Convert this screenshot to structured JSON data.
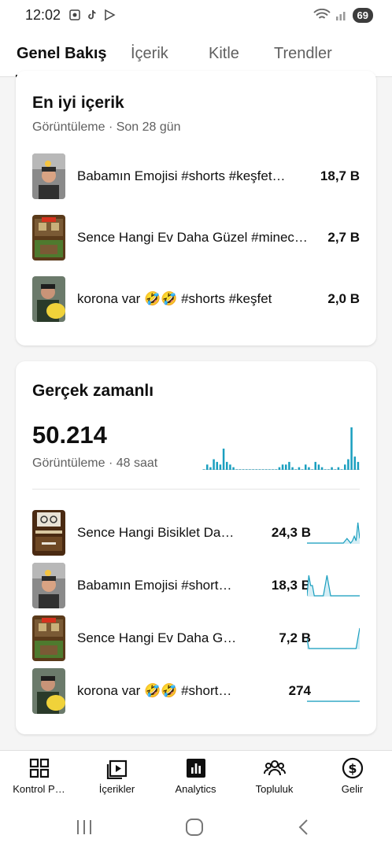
{
  "status": {
    "time": "12:02",
    "battery": "69"
  },
  "tabs": [
    {
      "label": "Genel Bakış",
      "active": true
    },
    {
      "label": "İçerik",
      "active": false
    },
    {
      "label": "Kitle",
      "active": false
    },
    {
      "label": "Trendler",
      "active": false
    }
  ],
  "top_content": {
    "title": "En iyi içerik",
    "subtitle": "Görüntüleme · Son 28 gün",
    "items": [
      {
        "title": "Babamın Emojisi #shorts #keşfet…",
        "value": "18,7 B"
      },
      {
        "title": "Sence Hangi Ev Daha Güzel #minec…",
        "value": "2,7 B"
      },
      {
        "title": "korona var 🤣🤣 #shorts #keşfet",
        "value": "2,0 B"
      }
    ]
  },
  "realtime": {
    "title": "Gerçek zamanlı",
    "total": "50.214",
    "subtitle": "Görüntüleme · 48 saat",
    "hourly_views": [
      0,
      2,
      1,
      4,
      3,
      2,
      8,
      3,
      2,
      1,
      0,
      0,
      0,
      0,
      0,
      0,
      0,
      0,
      0,
      0,
      0,
      0,
      0,
      1,
      2,
      2,
      3,
      1,
      0,
      1,
      0,
      2,
      1,
      0,
      3,
      2,
      1,
      0,
      0,
      1,
      0,
      1,
      0,
      2,
      4,
      16,
      5,
      3
    ],
    "items": [
      {
        "title": "Sence Hangi Bisiklet Da…",
        "value": "24,3 B",
        "spark": [
          0,
          0,
          0,
          0,
          0,
          0,
          0,
          0,
          0,
          0,
          0,
          0,
          0,
          0,
          0,
          0,
          0,
          0,
          0,
          0,
          0,
          1,
          2,
          1,
          0,
          1,
          3,
          1,
          9,
          2
        ]
      },
      {
        "title": "Babamın Emojisi #short…",
        "value": "18,3 B",
        "spark": [
          0,
          2,
          1,
          1,
          0,
          0,
          0,
          0,
          0,
          0,
          1,
          2,
          1,
          0,
          0,
          0,
          0,
          0,
          0,
          0,
          0,
          0,
          0,
          0,
          0,
          0,
          0,
          0,
          0,
          0
        ]
      },
      {
        "title": "Sence Hangi Ev Daha G…",
        "value": "7,2 B",
        "spark": [
          1,
          0,
          0,
          0,
          0,
          0,
          0,
          0,
          0,
          0,
          0,
          0,
          0,
          0,
          0,
          0,
          0,
          0,
          0,
          0,
          0,
          0,
          0,
          0,
          0,
          0,
          0,
          0,
          1,
          2
        ]
      },
      {
        "title": "korona var 🤣🤣 #short…",
        "value": "274",
        "spark": [
          0,
          0,
          0,
          0,
          0,
          0,
          0,
          0,
          0,
          0,
          0,
          0,
          0,
          0,
          0,
          0,
          0,
          0,
          0,
          0,
          0,
          0,
          0,
          0,
          0,
          0,
          0,
          0,
          0,
          0
        ]
      }
    ]
  },
  "bottom_nav": [
    {
      "label": "Kontrol P…",
      "icon": "dashboard-icon"
    },
    {
      "label": "İçerikler",
      "icon": "content-icon"
    },
    {
      "label": "Analytics",
      "icon": "analytics-icon"
    },
    {
      "label": "Topluluk",
      "icon": "community-icon"
    },
    {
      "label": "Gelir",
      "icon": "earn-icon"
    }
  ],
  "colors": {
    "accent": "#1a9fbf",
    "text": "#0f0f0f",
    "muted": "#606060"
  }
}
